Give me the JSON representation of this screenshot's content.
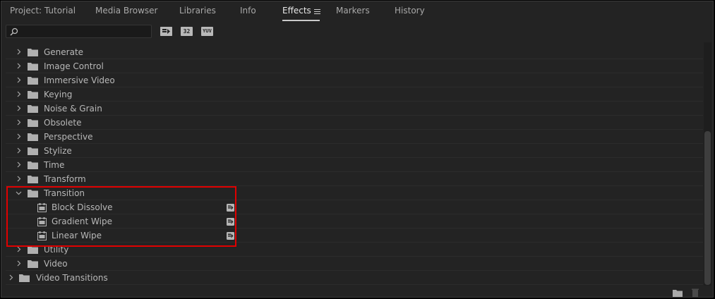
{
  "tabs": [
    {
      "label": "Project: Tutorial",
      "active": false
    },
    {
      "label": "Media Browser",
      "active": false
    },
    {
      "label": "Libraries",
      "active": false
    },
    {
      "label": "Info",
      "active": false
    },
    {
      "label": "Effects",
      "active": true
    },
    {
      "label": "Markers",
      "active": false
    },
    {
      "label": "History",
      "active": false
    }
  ],
  "search": {
    "value": "",
    "placeholder": ""
  },
  "filters": [
    {
      "name": "accelerated-effects",
      "label": ""
    },
    {
      "name": "32-bit-color",
      "label": "32"
    },
    {
      "name": "yuv",
      "label": "YUV"
    }
  ],
  "tree": [
    {
      "label": "Generate",
      "type": "folder",
      "expanded": false,
      "level": 1
    },
    {
      "label": "Image Control",
      "type": "folder",
      "expanded": false,
      "level": 1
    },
    {
      "label": "Immersive Video",
      "type": "folder",
      "expanded": false,
      "level": 1
    },
    {
      "label": "Keying",
      "type": "folder",
      "expanded": false,
      "level": 1
    },
    {
      "label": "Noise & Grain",
      "type": "folder",
      "expanded": false,
      "level": 1
    },
    {
      "label": "Obsolete",
      "type": "folder",
      "expanded": false,
      "level": 1
    },
    {
      "label": "Perspective",
      "type": "folder",
      "expanded": false,
      "level": 1
    },
    {
      "label": "Stylize",
      "type": "folder",
      "expanded": false,
      "level": 1
    },
    {
      "label": "Time",
      "type": "folder",
      "expanded": false,
      "level": 1
    },
    {
      "label": "Transform",
      "type": "folder",
      "expanded": false,
      "level": 1
    },
    {
      "label": "Transition",
      "type": "folder",
      "expanded": true,
      "level": 1
    },
    {
      "label": "Block Dissolve",
      "type": "effect",
      "accelerated": true,
      "level": 2
    },
    {
      "label": "Gradient Wipe",
      "type": "effect",
      "accelerated": true,
      "level": 2
    },
    {
      "label": "Linear Wipe",
      "type": "effect",
      "accelerated": true,
      "level": 2
    },
    {
      "label": "Utility",
      "type": "folder",
      "expanded": false,
      "level": 1
    },
    {
      "label": "Video",
      "type": "folder",
      "expanded": false,
      "level": 1
    },
    {
      "label": "Video Transitions",
      "type": "folder",
      "expanded": false,
      "level": 0
    }
  ],
  "colors": {
    "highlight": "#e00000",
    "panel": "#232323",
    "text": "#b8b8b8"
  }
}
